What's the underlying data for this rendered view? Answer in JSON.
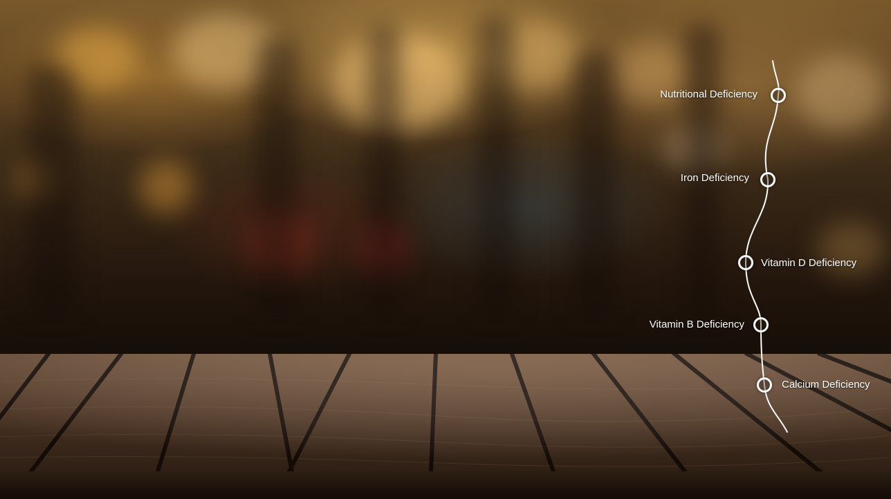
{
  "timeline": {
    "nodes": [
      {
        "label": "Nutritional Deficiency"
      },
      {
        "label": "Iron Deficiency"
      },
      {
        "label": "Vitamin D Deficiency"
      },
      {
        "label": "Vitamin B Deficiency"
      },
      {
        "label": "Calcium Deficiency"
      }
    ]
  },
  "colors": {
    "line": "#ffffff",
    "label_text": "#ffffff",
    "wood": "#6b4a32",
    "background_glow": "#e0b060"
  }
}
